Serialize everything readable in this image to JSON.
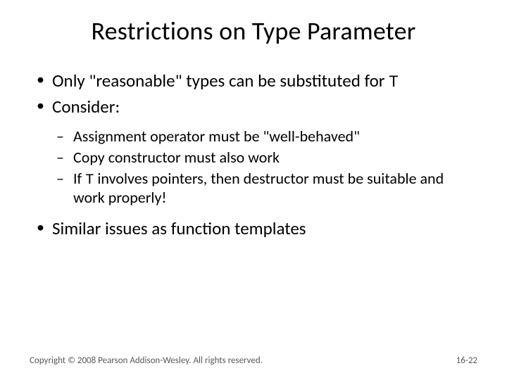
{
  "title": "Restrictions on Type Parameter",
  "bullets": {
    "b1_pre": "Only \"reasonable\" types can be substituted for ",
    "b1_code": "T",
    "b2": "Consider:",
    "sub": {
      "s1": "Assignment operator must be \"well-behaved\"",
      "s2": "Copy constructor must also work",
      "s3_pre": "If ",
      "s3_code": "T",
      "s3_post": " involves pointers, then destructor must be suitable and work properly!"
    },
    "b3": "Similar issues as function templates"
  },
  "footer": {
    "copyright": "Copyright © 2008 Pearson Addison-Wesley. All rights reserved.",
    "page": "16-22"
  }
}
